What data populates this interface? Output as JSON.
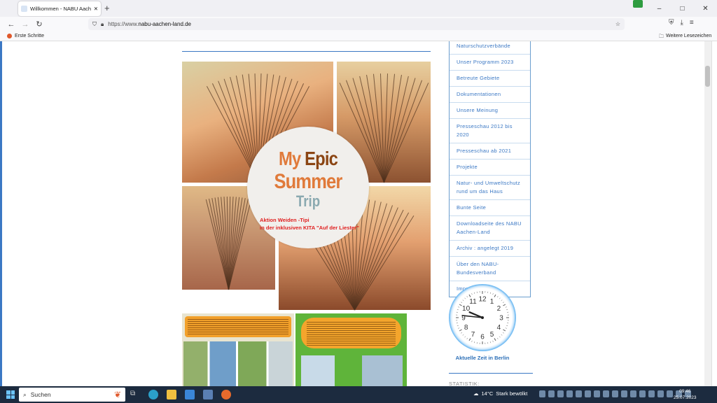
{
  "browser": {
    "tab_title": "Willkommen - NABU Aachen-L",
    "new_tab": "+",
    "url_prefix": "https://www.",
    "url_domain": "nabu-aachen-land.de",
    "bookmark_left": "Erste Schritte",
    "bookmark_right": "Weitere Lesezeichen",
    "window_buttons": [
      "–",
      "□",
      "✕"
    ]
  },
  "page": {
    "badge": {
      "line1_a": "My ",
      "line1_b": "Epic",
      "line2": "Summer",
      "line3": "Trip",
      "caption1": "Aktion Weiden -Tipi",
      "caption2": "in der inklusiven KITA  \"Auf der Liester\""
    },
    "menu": [
      "Naturschutzverbände",
      "Unser Programm 2023",
      "Betreute Gebiete",
      "Dokumentationen",
      "Unsere Meinung",
      "Presseschau 2012 bis 2020",
      "Presseschau ab 2021",
      "Projekte",
      "Natur- und Umweltschutz rund um das Haus",
      "Bunte Seite",
      "Downloadseite des NABU Aachen-Land",
      "Archiv : angelegt 2019",
      "Über den NABU-Bundesverband",
      "Impressum"
    ],
    "clock_caption": "Aktuelle Zeit in Berlin",
    "clock_numbers": [
      "12",
      "1",
      "2",
      "3",
      "4",
      "5",
      "6",
      "7",
      "8",
      "9",
      "10",
      "11"
    ],
    "clock_time": {
      "hour": 9,
      "minute": 46
    },
    "sidebar_heading": "STATISTIK:"
  },
  "taskbar": {
    "search_placeholder": "Suchen",
    "temperature": "14°C",
    "weather_text": "Stark bewölkt",
    "time": "09:46",
    "date": "25.07.2023"
  },
  "colors": {
    "accent": "#3b78c4",
    "taskbar": "#1c2b3f",
    "badge_orange": "#e07a3a"
  }
}
